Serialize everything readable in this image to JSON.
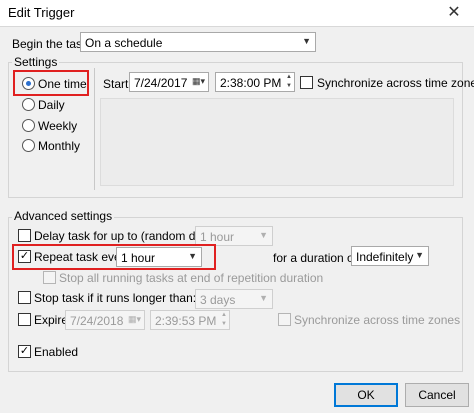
{
  "window": {
    "title": "Edit Trigger",
    "close_glyph": "✕"
  },
  "begin": {
    "label": "Begin the task:",
    "value": "On a schedule"
  },
  "settings": {
    "group_label": "Settings",
    "options": [
      "One time",
      "Daily",
      "Weekly",
      "Monthly"
    ],
    "selected": "One time",
    "start_label": "Start:",
    "start_date": "7/24/2017",
    "start_time": "2:38:00 PM",
    "sync_label": "Synchronize across time zones"
  },
  "advanced": {
    "group_label": "Advanced settings",
    "delay_label": "Delay task for up to (random delay):",
    "delay_value": "1 hour",
    "repeat_label": "Repeat task every:",
    "repeat_value": "1 hour",
    "duration_label": "for a duration of:",
    "duration_value": "Indefinitely",
    "stop_running_label": "Stop all running tasks at end of repetition duration",
    "stop_longer_label": "Stop task if it runs longer than:",
    "stop_longer_value": "3 days",
    "expire_label": "Expire:",
    "expire_date": "7/24/2018",
    "expire_time": "2:39:53 PM",
    "expire_sync_label": "Synchronize across time zones",
    "enabled_label": "Enabled"
  },
  "buttons": {
    "ok": "OK",
    "cancel": "Cancel"
  },
  "icons": {
    "dropdown": "chevron-down-icon",
    "calendar": "calendar-icon",
    "spinner": "spinner-icon",
    "check": "checkmark-icon"
  },
  "colors": {
    "highlight": "#e02020",
    "radio_accent": "#2b6fce",
    "default_button": "#0078d7"
  }
}
